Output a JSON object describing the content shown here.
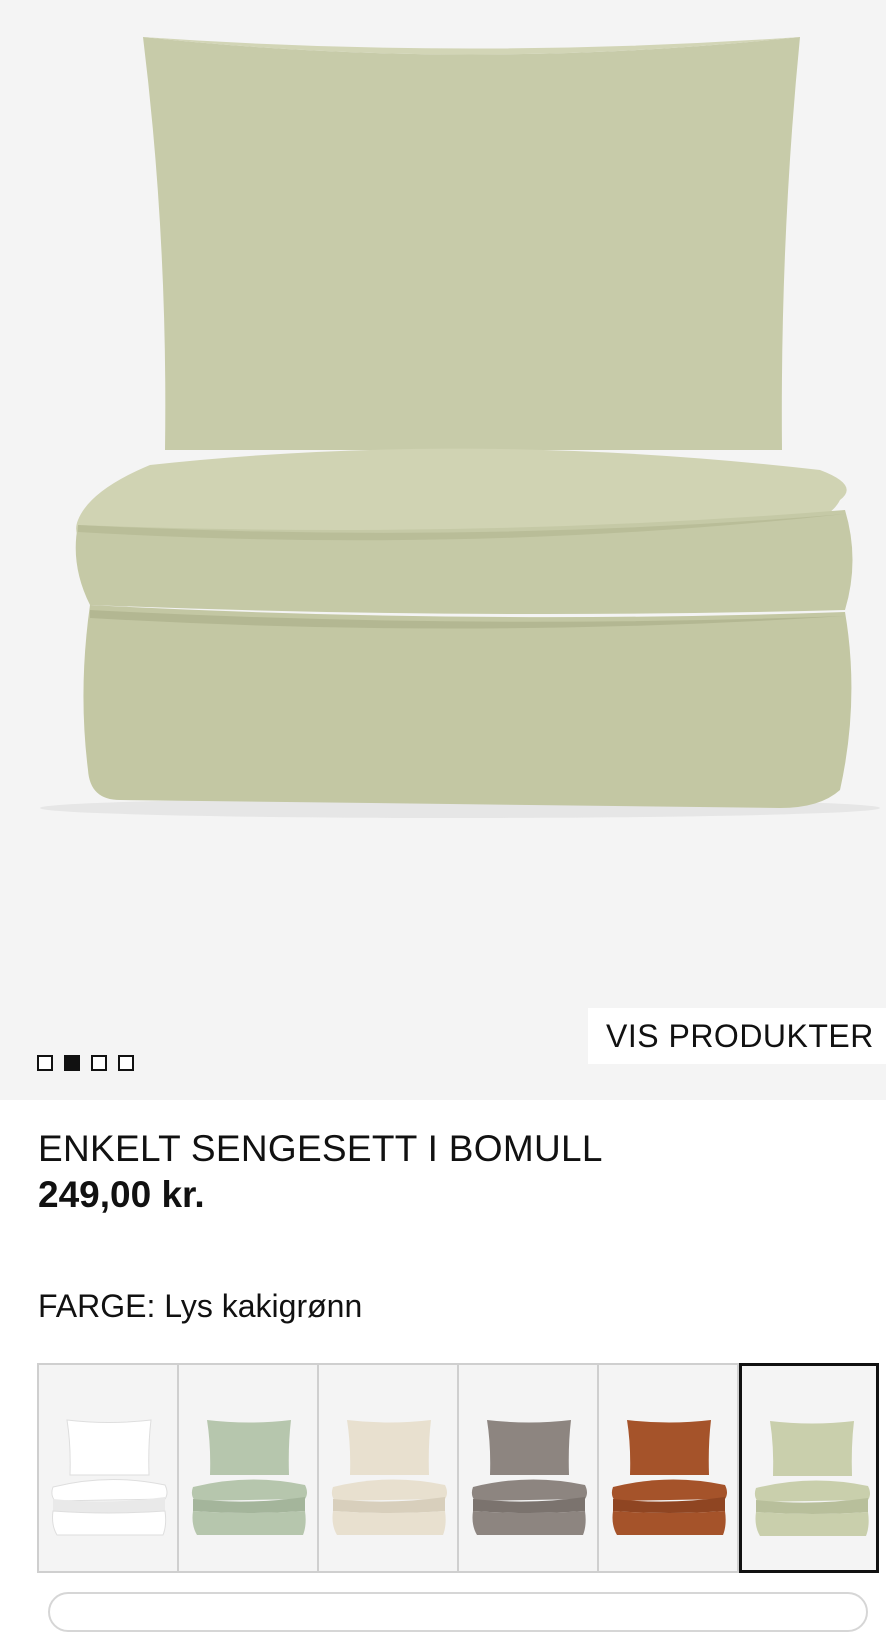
{
  "hero": {
    "image_name": "duvet-set-light-khaki-green",
    "button_label": "VIS PRODUKTER",
    "pager": {
      "total": 4,
      "active_index": 1
    }
  },
  "product": {
    "title": "ENKELT SENGESETT I BOMULL",
    "price": "249,00 kr."
  },
  "color": {
    "label": "FARGE:",
    "value": "Lys kakigrønn",
    "swatches": [
      {
        "name": "white",
        "fill": "#ffffff",
        "shade": "#e9e9e9",
        "selected": false
      },
      {
        "name": "sage-green",
        "fill": "#b6c6ad",
        "shade": "#a4b59b",
        "selected": false
      },
      {
        "name": "light-beige",
        "fill": "#e8e0cf",
        "shade": "#d8cfbc",
        "selected": false
      },
      {
        "name": "grey-brown",
        "fill": "#8d8580",
        "shade": "#7b736e",
        "selected": false
      },
      {
        "name": "rust-brown",
        "fill": "#a5532a",
        "shade": "#8f4522",
        "selected": false
      },
      {
        "name": "light-khaki-green",
        "fill": "#c9cfac",
        "shade": "#b8bf9b",
        "selected": true
      }
    ]
  },
  "colors": {
    "product_fill": "#c7cba9",
    "product_shade": "#b6bb97",
    "product_highlight": "#d4d7b9",
    "hero_background": "#f4f4f4"
  }
}
